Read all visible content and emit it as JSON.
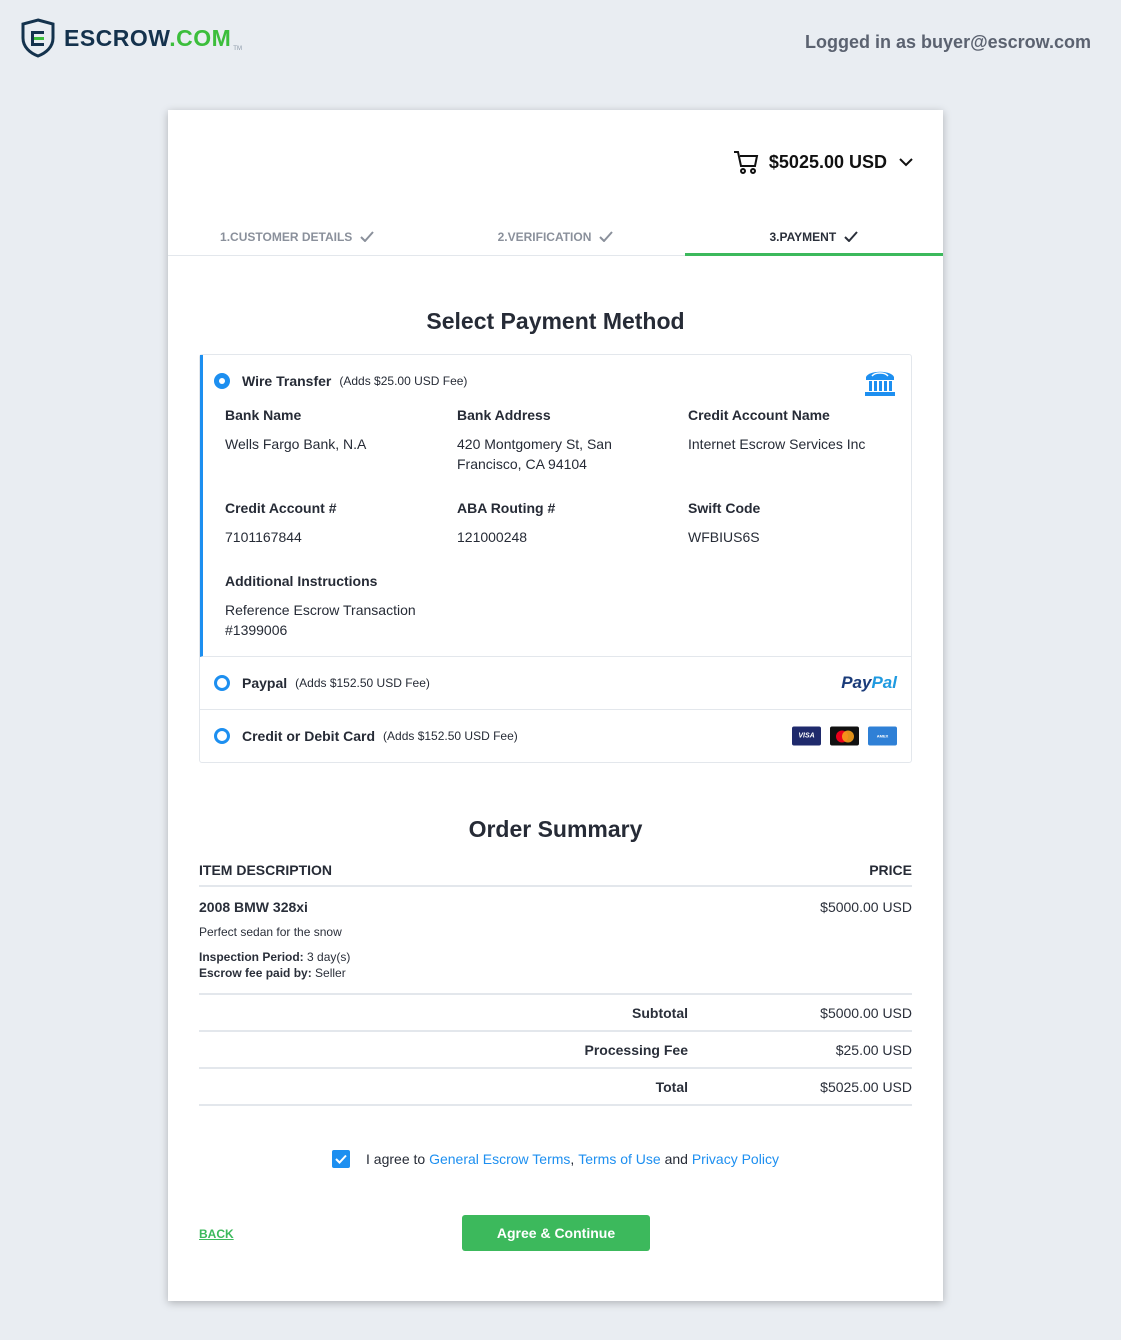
{
  "header": {
    "logo_text_main": "ESCROW",
    "logo_text_tld": ".COM",
    "logo_tm": "TM",
    "logged_in": "Logged in as buyer@escrow.com"
  },
  "cart": {
    "icon": "cart-icon",
    "amount": "$5025.00 USD",
    "toggle_icon": "chevron-down-icon"
  },
  "steps": [
    {
      "label": "1.CUSTOMER DETAILS",
      "state": "complete"
    },
    {
      "label": "2.VERIFICATION",
      "state": "complete"
    },
    {
      "label": "3.PAYMENT",
      "state": "active"
    }
  ],
  "payment": {
    "title": "Select Payment Method",
    "options": [
      {
        "name": "Wire Transfer",
        "fee": "(Adds $25.00 USD Fee)",
        "selected": true,
        "icon": "bank-icon",
        "details": [
          {
            "label": "Bank Name",
            "value": "Wells Fargo Bank, N.A"
          },
          {
            "label": "Bank Address",
            "value": "420 Montgomery St, San\nFrancisco, CA 94104"
          },
          {
            "label": "Credit Account Name",
            "value": "Internet Escrow Services Inc"
          },
          {
            "label": "Credit Account #",
            "value": "7101167844"
          },
          {
            "label": "ABA Routing #",
            "value": "121000248"
          },
          {
            "label": "Swift Code",
            "value": "WFBIUS6S"
          },
          {
            "label": "Additional Instructions",
            "value": "Reference Escrow Transaction\n#1399006"
          }
        ]
      },
      {
        "name": "Paypal",
        "fee": "(Adds $152.50 USD Fee)",
        "selected": false,
        "logo_part1": "Pay",
        "logo_part2": "Pal"
      },
      {
        "name": "Credit or Debit Card",
        "fee": "(Adds $152.50 USD Fee)",
        "selected": false,
        "cards": [
          "VISA",
          "mastercard",
          "AMEX"
        ]
      }
    ]
  },
  "order": {
    "title": "Order Summary",
    "col_item": "ITEM DESCRIPTION",
    "col_price": "PRICE",
    "item": {
      "title": "2008 BMW 328xi",
      "description": "Perfect sedan for the snow",
      "inspection_label": "Inspection Period:",
      "inspection_value": " 3 day(s)",
      "fee_label": "Escrow fee paid by:",
      "fee_value": " Seller",
      "price": "$5000.00 USD"
    },
    "totals": [
      {
        "label": "Subtotal",
        "value": "$5000.00 USD"
      },
      {
        "label": "Processing Fee",
        "value": "$25.00 USD"
      },
      {
        "label": "Total",
        "value": "$5025.00 USD"
      }
    ]
  },
  "agreement": {
    "checked": true,
    "prefix": "I agree to ",
    "link1": "General Escrow Terms",
    "sep": ", ",
    "link2": "Terms of Use",
    "and": " and ",
    "link3": "Privacy Policy"
  },
  "actions": {
    "back": "BACK",
    "continue": "Agree & Continue"
  },
  "colors": {
    "accent_blue": "#1d8ff0",
    "accent_green": "#3cb95c",
    "background": "#e9edf2"
  }
}
